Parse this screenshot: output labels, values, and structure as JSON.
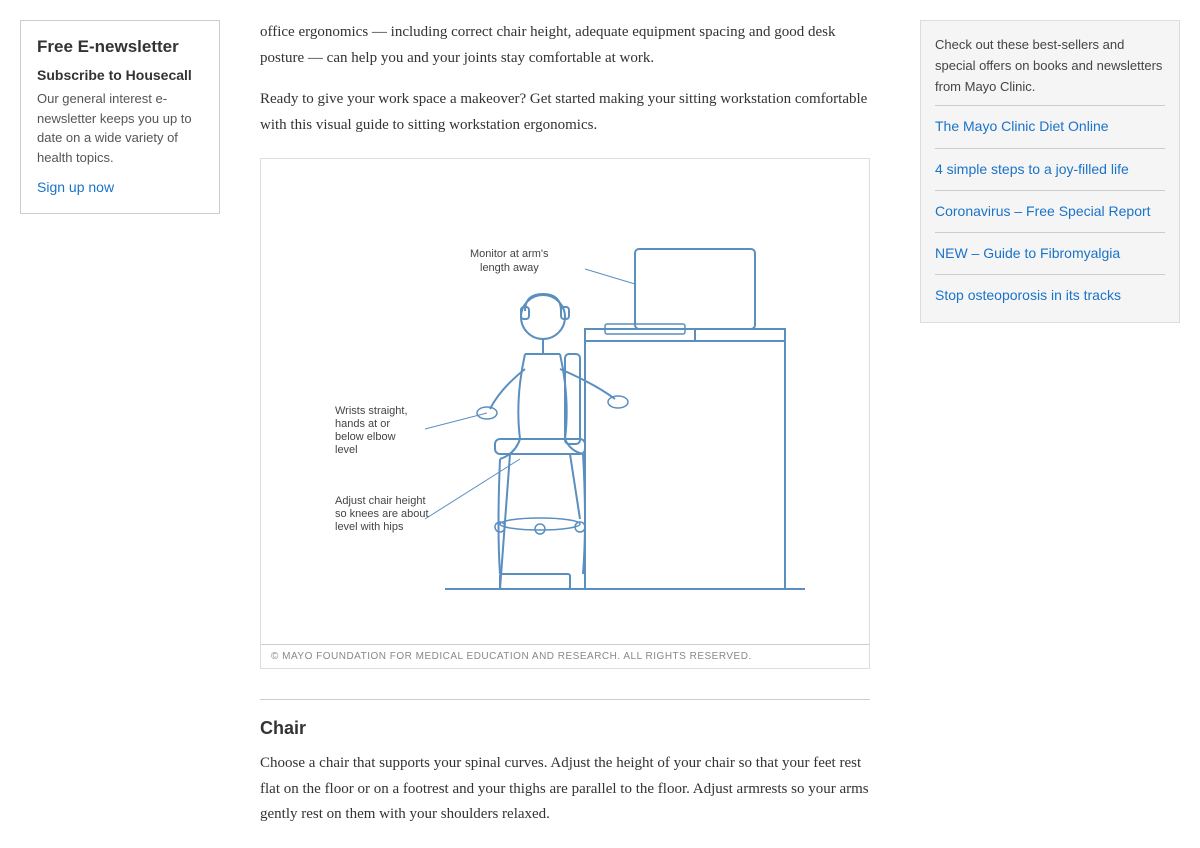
{
  "sidebar": {
    "title": "Free E-newsletter",
    "subscribe_label": "Subscribe to Housecall",
    "description": "Our general interest e-newsletter keeps you up to date on a wide variety of health topics.",
    "sign_up_label": "Sign up now"
  },
  "main": {
    "intro_text": "office ergonomics — including correct chair height, adequate equipment spacing and good desk posture — can help you and your joints stay comfortable at work.",
    "workstation_text": "Ready to give your work space a makeover? Get started making your sitting workstation comfortable with this visual guide to sitting workstation ergonomics.",
    "diagram_copyright": "© MAYO FOUNDATION FOR MEDICAL EDUCATION AND RESEARCH. ALL RIGHTS RESERVED.",
    "diagram_label1": "Monitor at arm's length away",
    "diagram_label2": "Wrists straight, hands at or below elbow level",
    "diagram_label3": "Adjust chair height so knees are about level with hips",
    "chair_heading": "Chair",
    "chair_text": "Choose a chair that supports your spinal curves. Adjust the height of your chair so that your feet rest flat on the floor or on a footrest and your thighs are parallel to the floor. Adjust armrests so your arms gently rest on them with your shoulders relaxed."
  },
  "right_sidebar": {
    "promo_text": "Check out these best-sellers and special offers on books and newsletters from Mayo Clinic.",
    "links": [
      {
        "label": "The Mayo Clinic Diet Online",
        "is_new": false
      },
      {
        "label": "4 simple steps to a joy-filled life",
        "is_new": false
      },
      {
        "label": "Coronavirus – Free Special Report",
        "is_new": false
      },
      {
        "label": "NEW – Guide to Fibromyalgia",
        "is_new": true
      },
      {
        "label": "Stop osteoporosis in its tracks",
        "is_new": false
      }
    ]
  }
}
